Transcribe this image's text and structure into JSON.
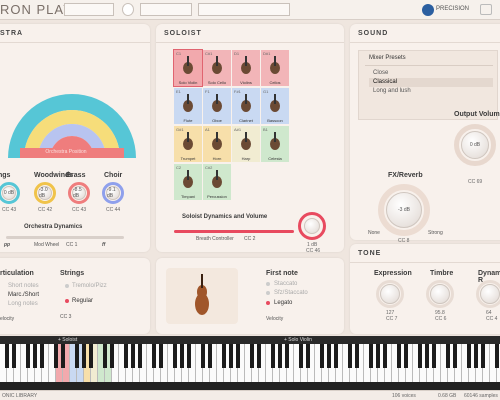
{
  "app": {
    "title": "RON PLAYER",
    "brand": "PRECISION",
    "bottom_left": "ONIC LIBRARY",
    "voices": "106 voices",
    "memory": "0.68 GB",
    "samples": "60146 samples"
  },
  "orchestra": {
    "title": "STRA",
    "sections": [
      {
        "label": "ngs",
        "value": "0 dB",
        "cc": "CC 43"
      },
      {
        "label": "Woodwinds",
        "value": "-3.0 dB",
        "cc": "CC 42"
      },
      {
        "label": "Brass",
        "value": "-8.5 dB",
        "cc": "CC 43"
      },
      {
        "label": "Choir",
        "value": "-9.1 dB",
        "cc": "CC 44"
      }
    ],
    "arc_caption": "Orchestra Position",
    "dynamics_label": "Orchestra Dynamics",
    "mod_wheel": "Mod Wheel",
    "cc1": "CC 1",
    "pp": "pp",
    "ff": "ff"
  },
  "articulation": {
    "title": "rticulation",
    "items": [
      "Short notes",
      "Marc./Short",
      "Long notes"
    ],
    "velocity": "elocity"
  },
  "strings": {
    "title": "Strings",
    "items": [
      "Tremolo/Pizz",
      "Regular"
    ],
    "cc": "CC 3"
  },
  "soloist": {
    "title": "SOLOIST",
    "instruments": [
      {
        "num": "C1",
        "name": "Solo Violin",
        "bg": "#f2a9ad"
      },
      {
        "num": "C#1",
        "name": "Solo Cello",
        "bg": "#f2b5b8"
      },
      {
        "num": "D1",
        "name": "Violins",
        "bg": "#f2b5b8"
      },
      {
        "num": "D#1",
        "name": "Cellos",
        "bg": "#f2b5b8"
      },
      {
        "num": "E1",
        "name": "Flute",
        "bg": "#c9d9f2"
      },
      {
        "num": "F1",
        "name": "Oboe",
        "bg": "#c9d9f2"
      },
      {
        "num": "F#1",
        "name": "Clarinet",
        "bg": "#c9d9f2"
      },
      {
        "num": "G1",
        "name": "Bassoon",
        "bg": "#c9d9f2"
      },
      {
        "num": "G#1",
        "name": "Trumpet",
        "bg": "#f7dfaa"
      },
      {
        "num": "A1",
        "name": "Horn",
        "bg": "#f7dfaa"
      },
      {
        "num": "A#1",
        "name": "Harp",
        "bg": "#f1ecd2"
      },
      {
        "num": "B1",
        "name": "Celesta",
        "bg": "#cfe8cd"
      },
      {
        "num": "C2",
        "name": "Timpani",
        "bg": "#cfe8cd"
      },
      {
        "num": "C#2",
        "name": "Percussion",
        "bg": "#cfe8cd"
      }
    ],
    "dyn_label": "Soloist Dynamics and Volume",
    "breath": "Breath Controller",
    "cc2": "CC 2",
    "vol_value": "1 dB",
    "vol_cc": "CC 46"
  },
  "first_note": {
    "title": "First note",
    "items": [
      "Staccato",
      "Sfz/Staccato",
      "Legato"
    ],
    "velocity": "Velocity"
  },
  "sound": {
    "title": "SOUND",
    "mixer_title": "Mixer Presets",
    "presets": [
      "Close",
      "Classical",
      "Long and lush"
    ],
    "output_label": "Output Volum",
    "output_value": "0 dB",
    "output_cc": "CC 69",
    "fx_label": "FX/Reverb",
    "fx_value": "-3 dB",
    "fx_cc": "CC 8",
    "none": "None",
    "strong": "Strong"
  },
  "tone": {
    "title": "TONE",
    "knobs": [
      {
        "label": "Expression",
        "value": "127",
        "cc": "CC 7"
      },
      {
        "label": "Timbre",
        "value": "95.8",
        "cc": "CC 6"
      },
      {
        "label": "Dynamic R",
        "value": "64",
        "cc": "CC 4"
      }
    ]
  },
  "keyboard": {
    "soloist_label": "+ Soloist",
    "solo_violin_label": "+ Solo Violin"
  }
}
